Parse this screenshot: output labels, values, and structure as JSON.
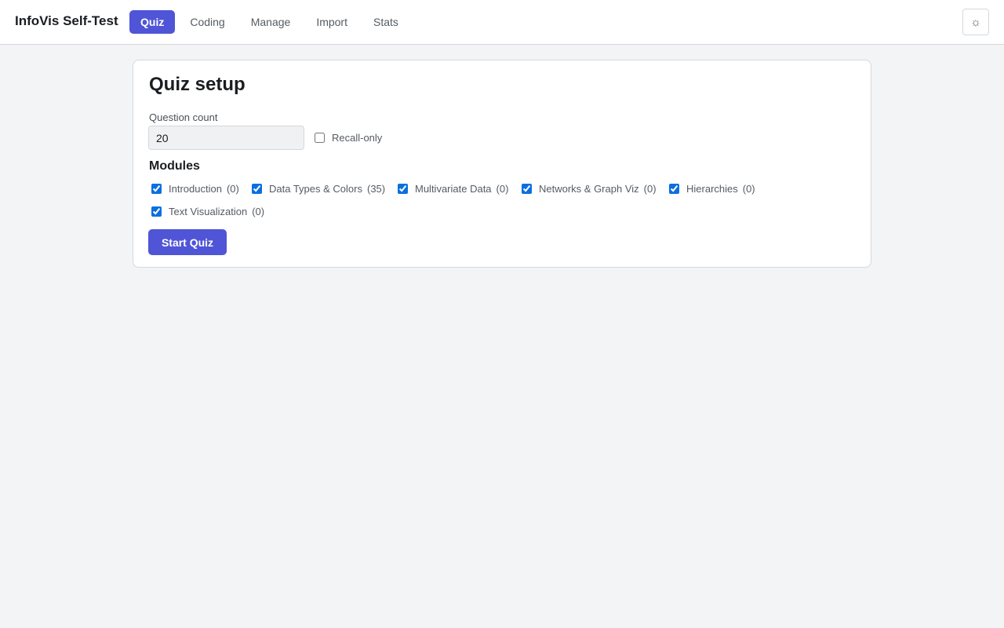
{
  "app": {
    "title": "InfoVis Self-Test"
  },
  "nav": {
    "tabs": [
      {
        "label": "Quiz",
        "active": true
      },
      {
        "label": "Coding",
        "active": false
      },
      {
        "label": "Manage",
        "active": false
      },
      {
        "label": "Import",
        "active": false
      },
      {
        "label": "Stats",
        "active": false
      }
    ]
  },
  "header": {
    "theme_icon": "☼",
    "theme_icon_name": "sun-icon"
  },
  "setup": {
    "title": "Quiz setup",
    "question_count_label": "Question count",
    "question_count_value": "20",
    "recall_only_label": "Recall-only",
    "recall_only_checked": false,
    "modules_heading": "Modules",
    "modules": [
      {
        "name": "Introduction",
        "count": "(0)",
        "checked": true
      },
      {
        "name": "Data Types & Colors",
        "count": "(35)",
        "checked": true
      },
      {
        "name": "Multivariate Data",
        "count": "(0)",
        "checked": true
      },
      {
        "name": "Networks & Graph Viz",
        "count": "(0)",
        "checked": true
      },
      {
        "name": "Hierarchies",
        "count": "(0)",
        "checked": true
      },
      {
        "name": "Text Visualization",
        "count": "(0)",
        "checked": true
      }
    ],
    "start_label": "Start Quiz"
  },
  "colors": {
    "accent": "#4f55d6",
    "checkbox": "#0b6fde",
    "background": "#f3f4f6"
  }
}
